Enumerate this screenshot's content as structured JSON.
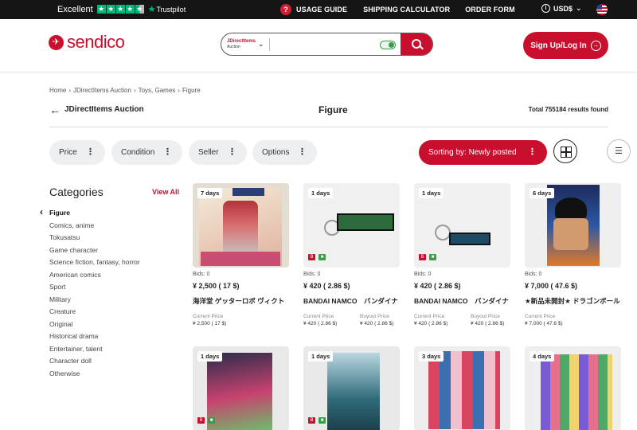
{
  "topbar": {
    "trustpilot_label": "Excellent",
    "trustpilot_brand": "Trustpilot",
    "nav": [
      "USAGE GUIDE",
      "SHIPPING CALCULATOR",
      "ORDER FORM"
    ],
    "currency": "USD$"
  },
  "header": {
    "logo_text": "sendico",
    "search_source_line1": "JDirectItems",
    "search_source_line2": "Auction",
    "search_value": "",
    "signup_label": "Sign Up/Log In"
  },
  "breadcrumb": [
    "Home",
    "›",
    "JDirectItems Auction",
    "›",
    "Toys, Games",
    "›",
    "Figure"
  ],
  "titlebar": {
    "auction": "JDirectItems Auction",
    "title": "Figure",
    "total": "Total 755184 results found"
  },
  "filters": [
    "Price",
    "Condition",
    "Seller",
    "Options"
  ],
  "sort_label": "Sorting by: Newly posted",
  "categories": {
    "title": "Categories",
    "view_all": "View All",
    "items": [
      "Figure",
      "Comics, anime",
      "Tokusatsu",
      "Game character",
      "Science fiction, fantasy, horror",
      "American comics",
      "Sport",
      "Military",
      "Creature",
      "Original",
      "Historical drama",
      "Entertainer, talent",
      "Character doll",
      "Otherwise"
    ]
  },
  "products": [
    {
      "days": "7 days",
      "bids": "Bids: 0",
      "price": "¥ 2,500 ( 17 $)",
      "name": "海洋堂 ゲッターロボ ヴィクト",
      "current_label": "Current Price",
      "current": "¥ 2,500 ( 17 $)",
      "buyout_label": "",
      "buyout": ""
    },
    {
      "days": "1 days",
      "bids": "Bids: 0",
      "price": "¥ 420 ( 2.86 $)",
      "name": "BANDAI NAMCO　バンダイナ",
      "current_label": "Current Price",
      "current": "¥ 420 ( 2.86 $)",
      "buyout_label": "Buyout Price",
      "buyout": "¥ 420 ( 2.86 $)"
    },
    {
      "days": "1 days",
      "bids": "Bids: 0",
      "price": "¥ 420 ( 2.86 $)",
      "name": "BANDAI NAMCO　バンダイナ",
      "current_label": "Current Price",
      "current": "¥ 420 ( 2.86 $)",
      "buyout_label": "Buyout Price",
      "buyout": "¥ 420 ( 2.86 $)"
    },
    {
      "days": "6 days",
      "bids": "Bids: 0",
      "price": "¥ 7,000 ( 47.6 $)",
      "name": "★新品未開封★ ドラゴンボール",
      "current_label": "Current Price",
      "current": "¥ 7,000 ( 47.6 $)",
      "buyout_label": "",
      "buyout": ""
    },
    {
      "days": "1 days"
    },
    {
      "days": "1 days"
    },
    {
      "days": "3 days"
    },
    {
      "days": "4 days"
    }
  ],
  "colors": {
    "brand": "#c8102e",
    "trustpilot": "#00b67a",
    "topbar_bg": "#151515"
  }
}
